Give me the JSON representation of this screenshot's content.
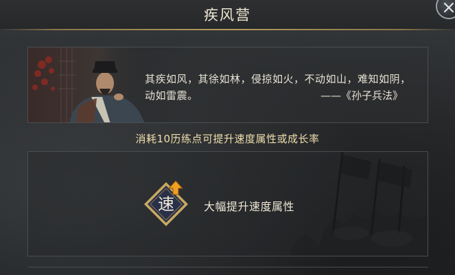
{
  "header": {
    "title": "疾风营",
    "close_icon": "close-x-icon"
  },
  "quote": {
    "text": "其疾如风，其徐如林，侵掠如火，不动如山，难知如阴，动如雷震。",
    "source": "——《孙子兵法》",
    "portrait_icon": "strategist-portrait"
  },
  "cost_text": "消耗10历练点可提升速度属性或成长率",
  "option": {
    "badge_char": "速",
    "badge_icon": "speed-up-arrow-icon",
    "label": "大幅提升速度属性"
  },
  "colors": {
    "accent_gold": "#b69b5e",
    "cost_text": "#f0dfae",
    "badge_fill": "#28304a",
    "badge_border": "#c9a961",
    "arrow": "#f0a020"
  }
}
